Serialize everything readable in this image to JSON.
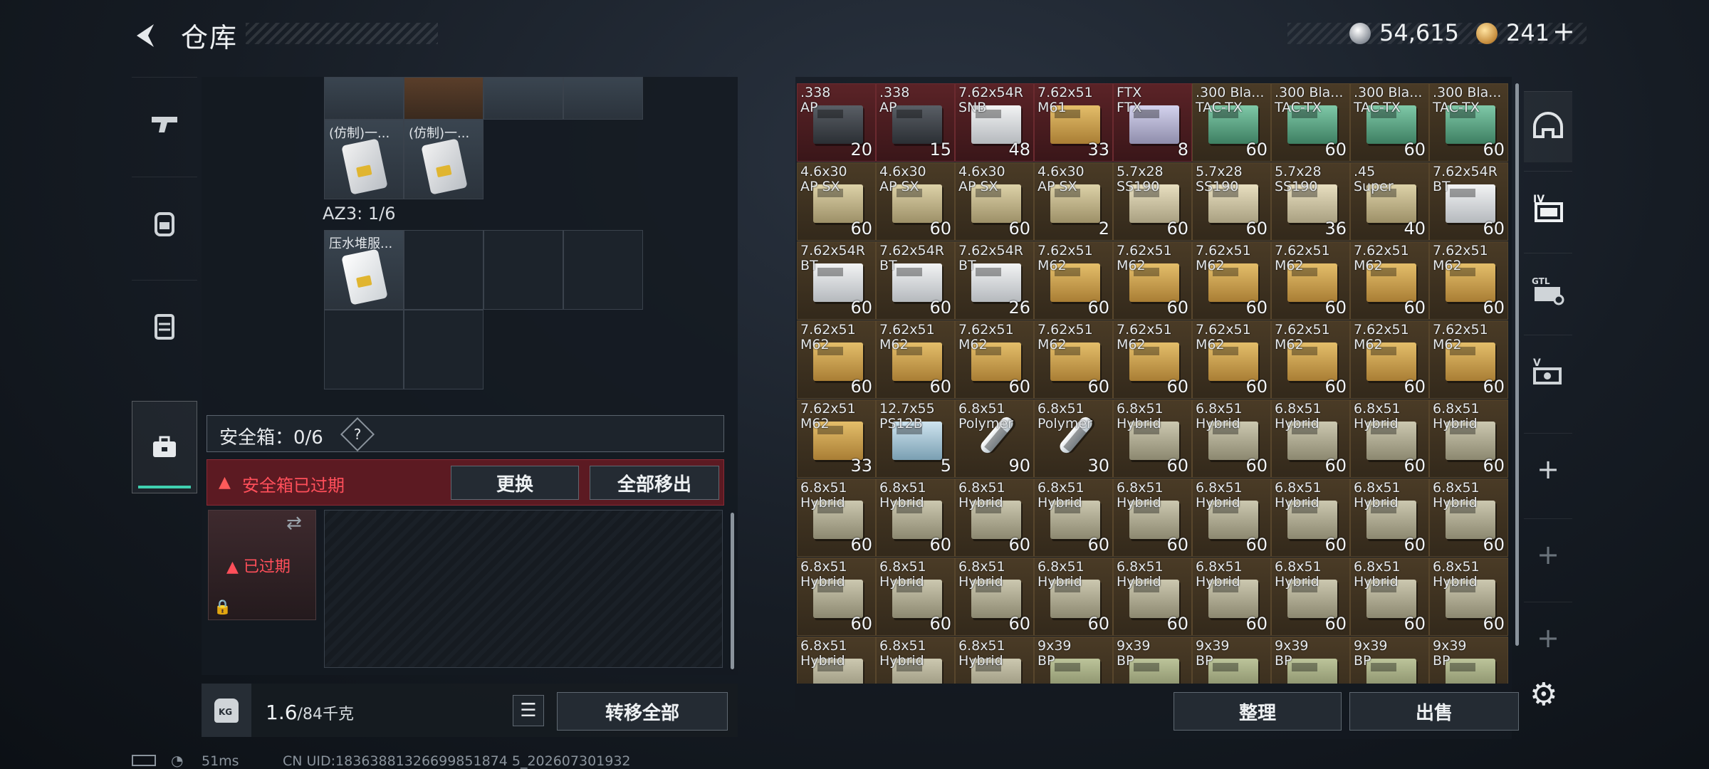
{
  "header": {
    "title": "仓库",
    "silver_amount": "54,615",
    "gold_amount": "241",
    "gold_plus": "+"
  },
  "left_nav": [
    "gun-icon",
    "backpack-icon",
    "chest-rig-icon",
    "safe-box-icon"
  ],
  "left_panel": {
    "top_cards": [
      "(仿制)一...",
      "(仿制)一..."
    ],
    "az3_label": "AZ3: 1/6",
    "az3_item": "压水堆服...",
    "safe_label": "安全箱：0/6",
    "safe_help": "?",
    "safe_expired_notice": "安全箱已过期",
    "replace_label": "更换",
    "move_all_label": "全部移出",
    "safe_expired_tag": "已过期"
  },
  "weight": {
    "current": "1.6",
    "limit": "/84千克"
  },
  "transfer_all_label": "转移全部",
  "grid_items": [
    [
      {
        "n": ".338\nAP",
        "c": "20",
        "t": "dark",
        "bg": "red"
      },
      {
        "n": ".338\nAP",
        "c": "15",
        "t": "dark",
        "bg": "red"
      },
      {
        "n": "7.62x54R\nSNB",
        "c": "48",
        "t": "white",
        "bg": "red"
      },
      {
        "n": "7.62x51\nM61",
        "c": "33",
        "t": "tan",
        "bg": "red"
      },
      {
        "n": "FTX\nFTX",
        "c": "8",
        "t": "lav",
        "bg": "red"
      },
      {
        "n": ".300 Bla...\nTAC-TX",
        "c": "60",
        "t": "green",
        "bg": "brown"
      },
      {
        "n": ".300 Bla...\nTAC-TX",
        "c": "60",
        "t": "green",
        "bg": "brown"
      },
      {
        "n": ".300 Bla...\nTAC-TX",
        "c": "60",
        "t": "green",
        "bg": "brown"
      },
      {
        "n": ".300 Bla...\nTAC-TX",
        "c": "60",
        "t": "green",
        "bg": "brown"
      }
    ],
    [
      {
        "n": "4.6x30\nAP SX",
        "c": "60",
        "t": "beige",
        "bg": "brown"
      },
      {
        "n": "4.6x30\nAP SX",
        "c": "60",
        "t": "beige",
        "bg": "brown"
      },
      {
        "n": "4.6x30\nAP SX",
        "c": "60",
        "t": "beige",
        "bg": "brown"
      },
      {
        "n": "4.6x30\nAP SX",
        "c": "2",
        "t": "beige",
        "bg": "brown"
      },
      {
        "n": "5.7x28\nSS190",
        "c": "60",
        "t": "cream",
        "bg": "brown"
      },
      {
        "n": "5.7x28\nSS190",
        "c": "60",
        "t": "cream",
        "bg": "brown"
      },
      {
        "n": "5.7x28\nSS190",
        "c": "36",
        "t": "cream",
        "bg": "brown"
      },
      {
        "n": ".45\nSuper",
        "c": "40",
        "t": "beige",
        "bg": "brown"
      },
      {
        "n": "7.62x54R\nBT",
        "c": "60",
        "t": "white",
        "bg": "brown"
      }
    ],
    [
      {
        "n": "7.62x54R\nBT",
        "c": "60",
        "t": "white",
        "bg": "brown"
      },
      {
        "n": "7.62x54R\nBT",
        "c": "60",
        "t": "white",
        "bg": "brown"
      },
      {
        "n": "7.62x54R\nBT",
        "c": "26",
        "t": "white",
        "bg": "brown"
      },
      {
        "n": "7.62x51\nM62",
        "c": "60",
        "t": "tan",
        "bg": "brown"
      },
      {
        "n": "7.62x51\nM62",
        "c": "60",
        "t": "tan",
        "bg": "brown"
      },
      {
        "n": "7.62x51\nM62",
        "c": "60",
        "t": "tan",
        "bg": "brown"
      },
      {
        "n": "7.62x51\nM62",
        "c": "60",
        "t": "tan",
        "bg": "brown"
      },
      {
        "n": "7.62x51\nM62",
        "c": "60",
        "t": "tan",
        "bg": "brown"
      },
      {
        "n": "7.62x51\nM62",
        "c": "60",
        "t": "tan",
        "bg": "brown"
      }
    ],
    [
      {
        "n": "7.62x51\nM62",
        "c": "60",
        "t": "tan",
        "bg": "brown"
      },
      {
        "n": "7.62x51\nM62",
        "c": "60",
        "t": "tan",
        "bg": "brown"
      },
      {
        "n": "7.62x51\nM62",
        "c": "60",
        "t": "tan",
        "bg": "brown"
      },
      {
        "n": "7.62x51\nM62",
        "c": "60",
        "t": "tan",
        "bg": "brown"
      },
      {
        "n": "7.62x51\nM62",
        "c": "60",
        "t": "tan",
        "bg": "brown"
      },
      {
        "n": "7.62x51\nM62",
        "c": "60",
        "t": "tan",
        "bg": "brown"
      },
      {
        "n": "7.62x51\nM62",
        "c": "60",
        "t": "tan",
        "bg": "brown"
      },
      {
        "n": "7.62x51\nM62",
        "c": "60",
        "t": "tan",
        "bg": "brown"
      },
      {
        "n": "7.62x51\nM62",
        "c": "60",
        "t": "tan",
        "bg": "brown"
      }
    ],
    [
      {
        "n": "7.62x51\nM62",
        "c": "33",
        "t": "tan",
        "bg": "brown"
      },
      {
        "n": "12.7x55\nPS12B",
        "c": "5",
        "t": "blue",
        "bg": "brown"
      },
      {
        "n": "6.8x51\nPolymer",
        "c": "90",
        "t": "syr",
        "bg": "brown"
      },
      {
        "n": "6.8x51\nPolymer",
        "c": "30",
        "t": "syr",
        "bg": "brown"
      },
      {
        "n": "6.8x51\nHybrid",
        "c": "60",
        "t": "pink",
        "bg": "brown"
      },
      {
        "n": "6.8x51\nHybrid",
        "c": "60",
        "t": "pink",
        "bg": "brown"
      },
      {
        "n": "6.8x51\nHybrid",
        "c": "60",
        "t": "pink",
        "bg": "brown"
      },
      {
        "n": "6.8x51\nHybrid",
        "c": "60",
        "t": "pink",
        "bg": "brown"
      },
      {
        "n": "6.8x51\nHybrid",
        "c": "60",
        "t": "pink",
        "bg": "brown"
      }
    ],
    [
      {
        "n": "6.8x51\nHybrid",
        "c": "60",
        "t": "pink",
        "bg": "brown"
      },
      {
        "n": "6.8x51\nHybrid",
        "c": "60",
        "t": "pink",
        "bg": "brown"
      },
      {
        "n": "6.8x51\nHybrid",
        "c": "60",
        "t": "pink",
        "bg": "brown"
      },
      {
        "n": "6.8x51\nHybrid",
        "c": "60",
        "t": "pink",
        "bg": "brown"
      },
      {
        "n": "6.8x51\nHybrid",
        "c": "60",
        "t": "pink",
        "bg": "brown"
      },
      {
        "n": "6.8x51\nHybrid",
        "c": "60",
        "t": "pink",
        "bg": "brown"
      },
      {
        "n": "6.8x51\nHybrid",
        "c": "60",
        "t": "pink",
        "bg": "brown"
      },
      {
        "n": "6.8x51\nHybrid",
        "c": "60",
        "t": "pink",
        "bg": "brown"
      },
      {
        "n": "6.8x51\nHybrid",
        "c": "60",
        "t": "pink",
        "bg": "brown"
      }
    ],
    [
      {
        "n": "6.8x51\nHybrid",
        "c": "60",
        "t": "pink",
        "bg": "brown"
      },
      {
        "n": "6.8x51\nHybrid",
        "c": "60",
        "t": "pink",
        "bg": "brown"
      },
      {
        "n": "6.8x51\nHybrid",
        "c": "60",
        "t": "pink",
        "bg": "brown"
      },
      {
        "n": "6.8x51\nHybrid",
        "c": "60",
        "t": "pink",
        "bg": "brown"
      },
      {
        "n": "6.8x51\nHybrid",
        "c": "60",
        "t": "pink",
        "bg": "brown"
      },
      {
        "n": "6.8x51\nHybrid",
        "c": "60",
        "t": "pink",
        "bg": "brown"
      },
      {
        "n": "6.8x51\nHybrid",
        "c": "60",
        "t": "pink",
        "bg": "brown"
      },
      {
        "n": "6.8x51\nHybrid",
        "c": "60",
        "t": "pink",
        "bg": "brown"
      },
      {
        "n": "6.8x51\nHybrid",
        "c": "60",
        "t": "pink",
        "bg": "brown"
      }
    ],
    [
      {
        "n": "6.8x51\nHybrid",
        "c": "",
        "t": "pink",
        "bg": "brown"
      },
      {
        "n": "6.8x51\nHybrid",
        "c": "",
        "t": "pink",
        "bg": "brown"
      },
      {
        "n": "6.8x51\nHybrid",
        "c": "",
        "t": "pink",
        "bg": "brown"
      },
      {
        "n": "9x39\nBP",
        "c": "",
        "t": "olive",
        "bg": "brown"
      },
      {
        "n": "9x39\nBP",
        "c": "",
        "t": "olive",
        "bg": "brown"
      },
      {
        "n": "9x39\nBP",
        "c": "",
        "t": "olive",
        "bg": "brown"
      },
      {
        "n": "9x39\nBP",
        "c": "",
        "t": "olive",
        "bg": "brown"
      },
      {
        "n": "9x39\nBP",
        "c": "",
        "t": "olive",
        "bg": "brown"
      },
      {
        "n": "9x39\nBP",
        "c": "",
        "t": "olive",
        "bg": "brown"
      }
    ]
  ],
  "actions": {
    "sort_label": "整理",
    "sell_label": "出售"
  },
  "right_tabs": [
    "helmet-icon",
    "ammo-box-iv-icon",
    "gtl-box-icon",
    "v-case-icon"
  ],
  "right_plus": [
    "+",
    "+",
    "+"
  ],
  "status": {
    "ping": "51ms",
    "uid": "CN UID:18363881326699851874 5_202607301932"
  }
}
